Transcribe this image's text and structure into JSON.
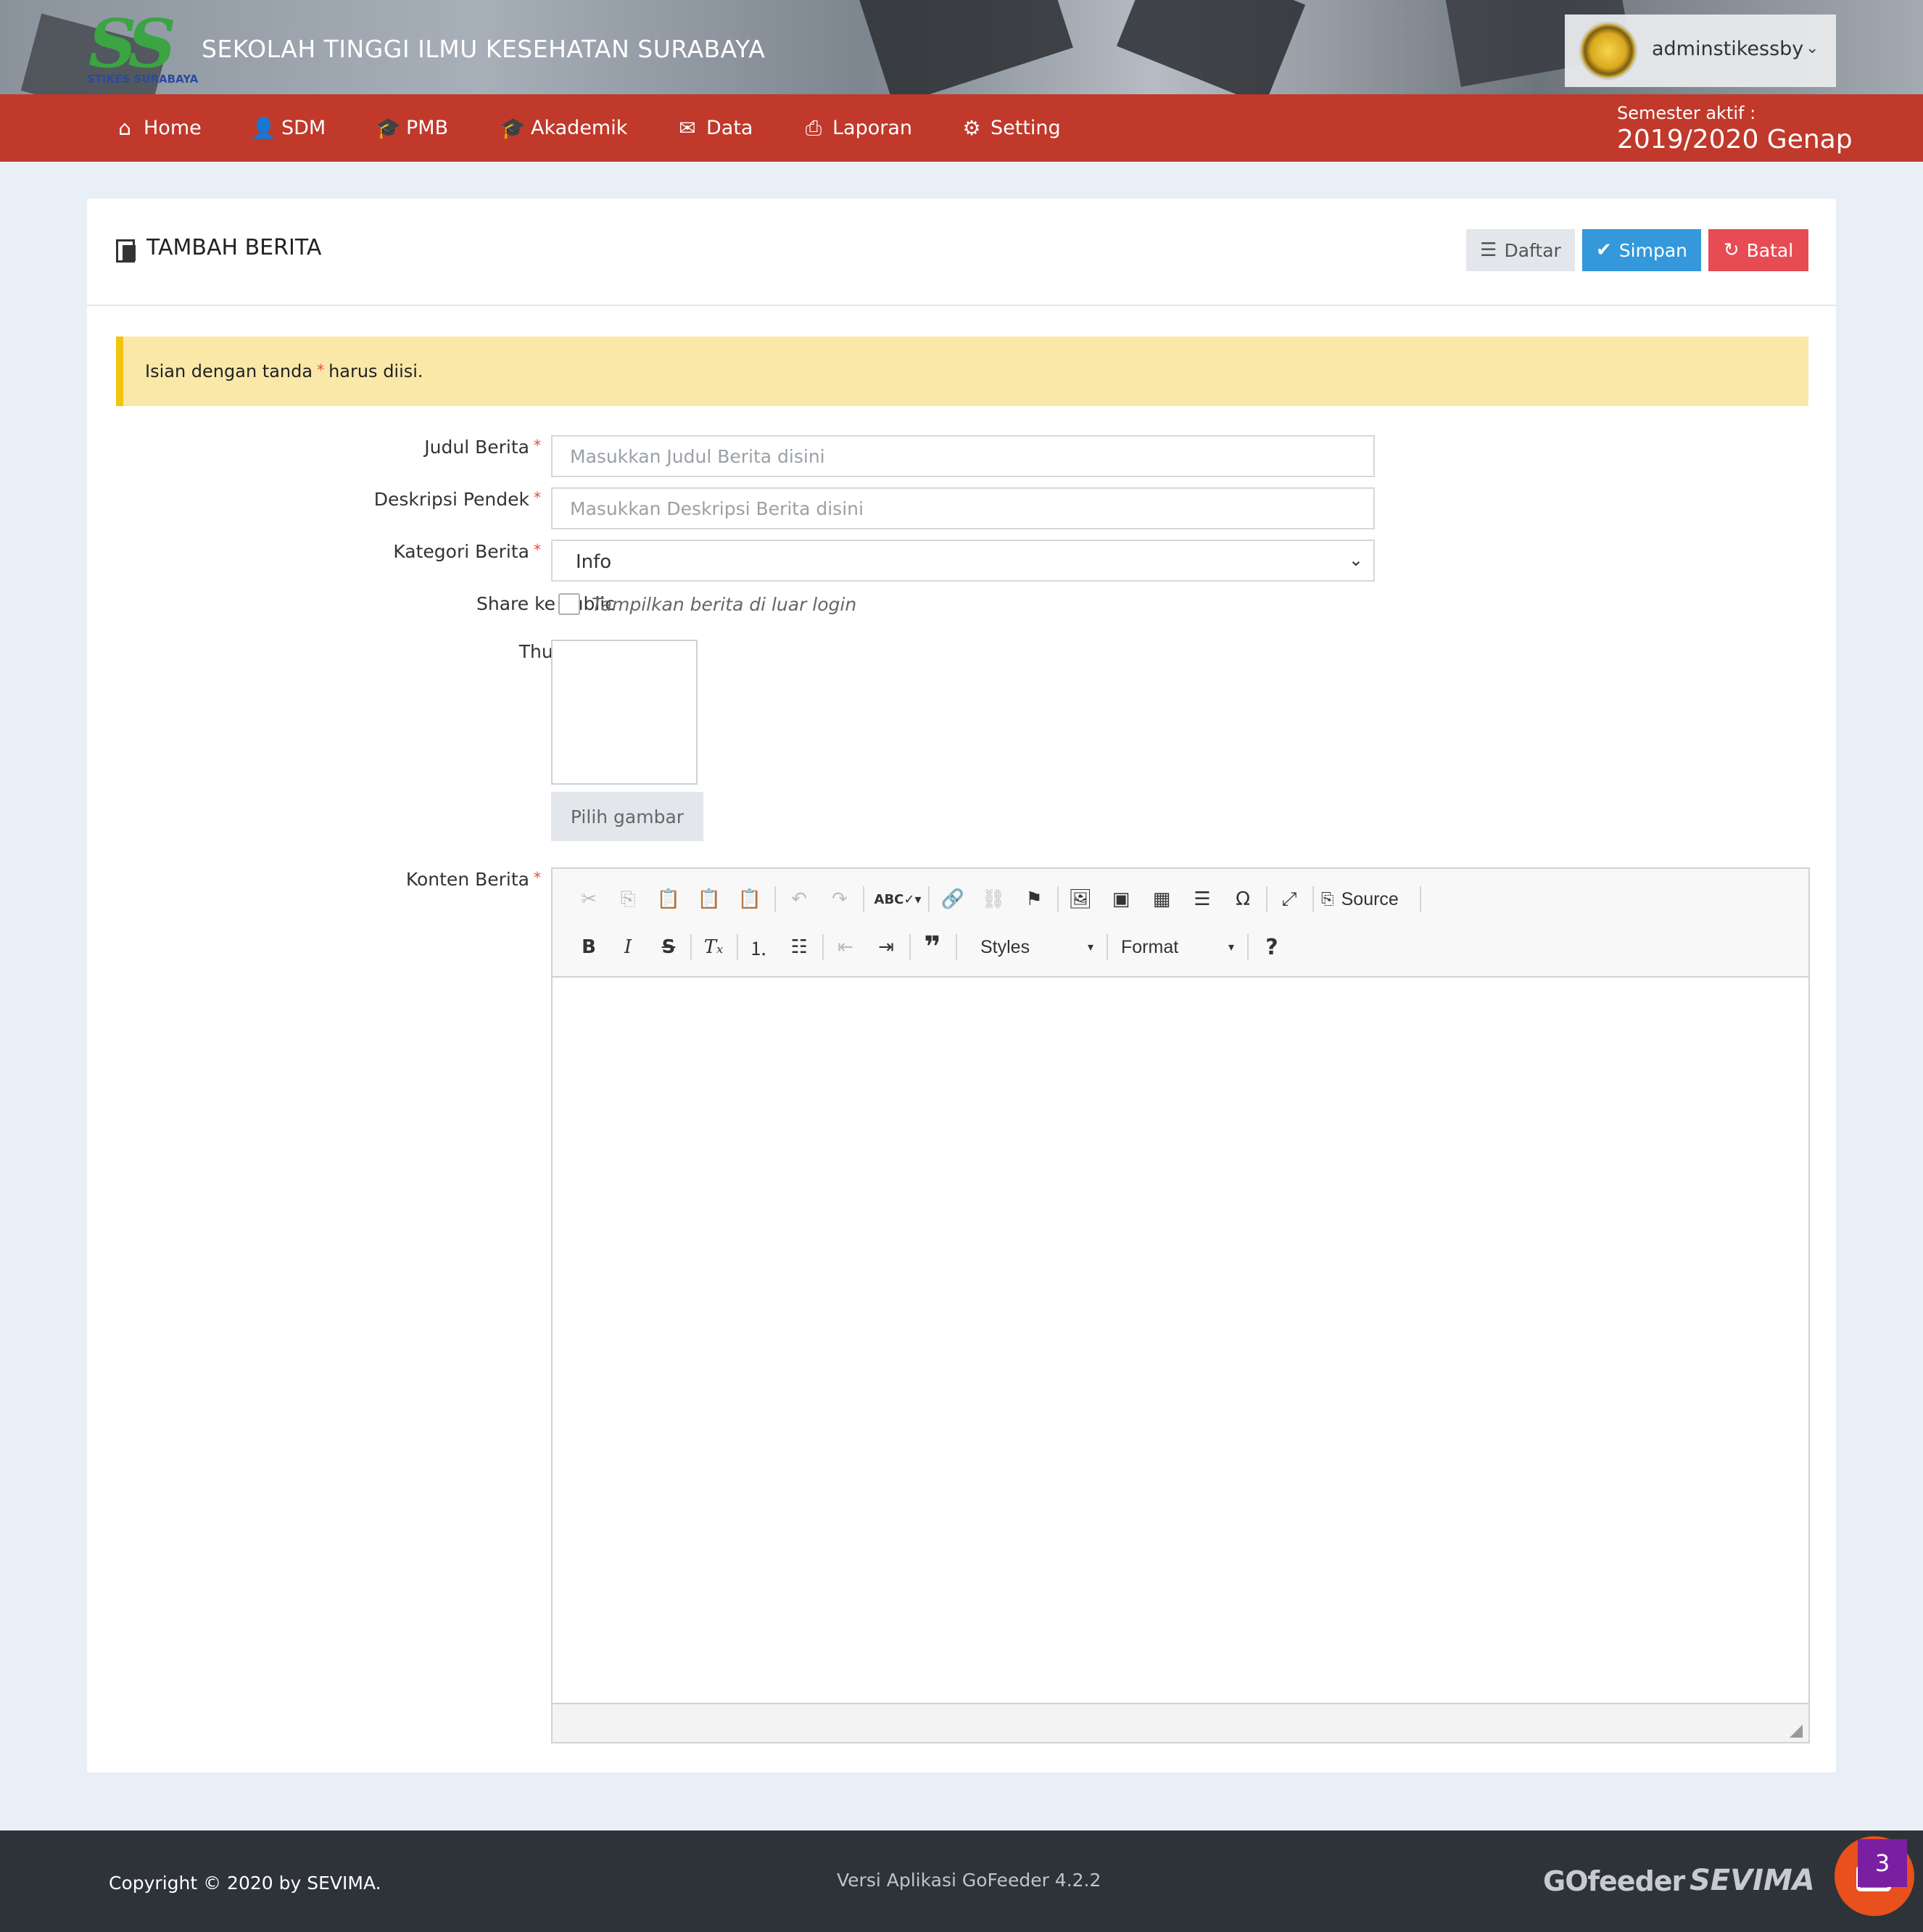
{
  "header": {
    "logo_text": "SS",
    "logo_subtitle": "STIKES SURABAYA",
    "site_title": "SEKOLAH TINGGI ILMU KESEHATAN SURABAYA",
    "username": "adminstikessby",
    "user_chevron_icon": "chevron-down-icon"
  },
  "nav": {
    "items": [
      {
        "label": "Home",
        "icon": "home-icon",
        "glyph": "⌂"
      },
      {
        "label": "SDM",
        "icon": "user-icon",
        "glyph": "👤"
      },
      {
        "label": "PMB",
        "icon": "graduation-cap-icon",
        "glyph": "🎓"
      },
      {
        "label": "Akademik",
        "icon": "graduation-cap-icon",
        "glyph": "🎓"
      },
      {
        "label": "Data",
        "icon": "inbox-icon",
        "glyph": "✉"
      },
      {
        "label": "Laporan",
        "icon": "printer-icon",
        "glyph": "⎙"
      },
      {
        "label": "Setting",
        "icon": "gear-icon",
        "glyph": "⚙"
      }
    ],
    "semester_label": "Semester aktif :",
    "semester_value": "2019/2020 Genap"
  },
  "page": {
    "title": "TAMBAH BERITA",
    "buttons": {
      "daftar": "Daftar",
      "simpan": "Simpan",
      "batal": "Batal"
    }
  },
  "alert": {
    "text_before": "Isian dengan tanda",
    "marker": "*",
    "text_after": "harus diisi."
  },
  "form": {
    "judul_label": "Judul Berita",
    "judul_placeholder": "Masukkan Judul Berita disini",
    "deskripsi_label": "Deskripsi Pendek",
    "deskripsi_placeholder": "Masukkan Deskripsi Berita disini",
    "kategori_label": "Kategori Berita",
    "kategori_value": "Info",
    "share_label": "Share ke Public",
    "share_checkbox_label": "Tampilkan berita di luar login",
    "share_checked": false,
    "thumbnail_label": "Thumbnail",
    "pilih_gambar": "Pilih gambar",
    "konten_label": "Konten Berita",
    "required_marker": "*"
  },
  "editor": {
    "source_label": "Source",
    "styles_label": "Styles",
    "format_label": "Format",
    "help_glyph": "?"
  },
  "footer": {
    "copyright": "Copyright © 2020 by SEVIMA.",
    "version": "Versi Aplikasi GoFeeder 4.2.2",
    "brand_gofeeder": "GOfeeder",
    "brand_sevima": "SEVIMA",
    "chat_badge": "3"
  }
}
